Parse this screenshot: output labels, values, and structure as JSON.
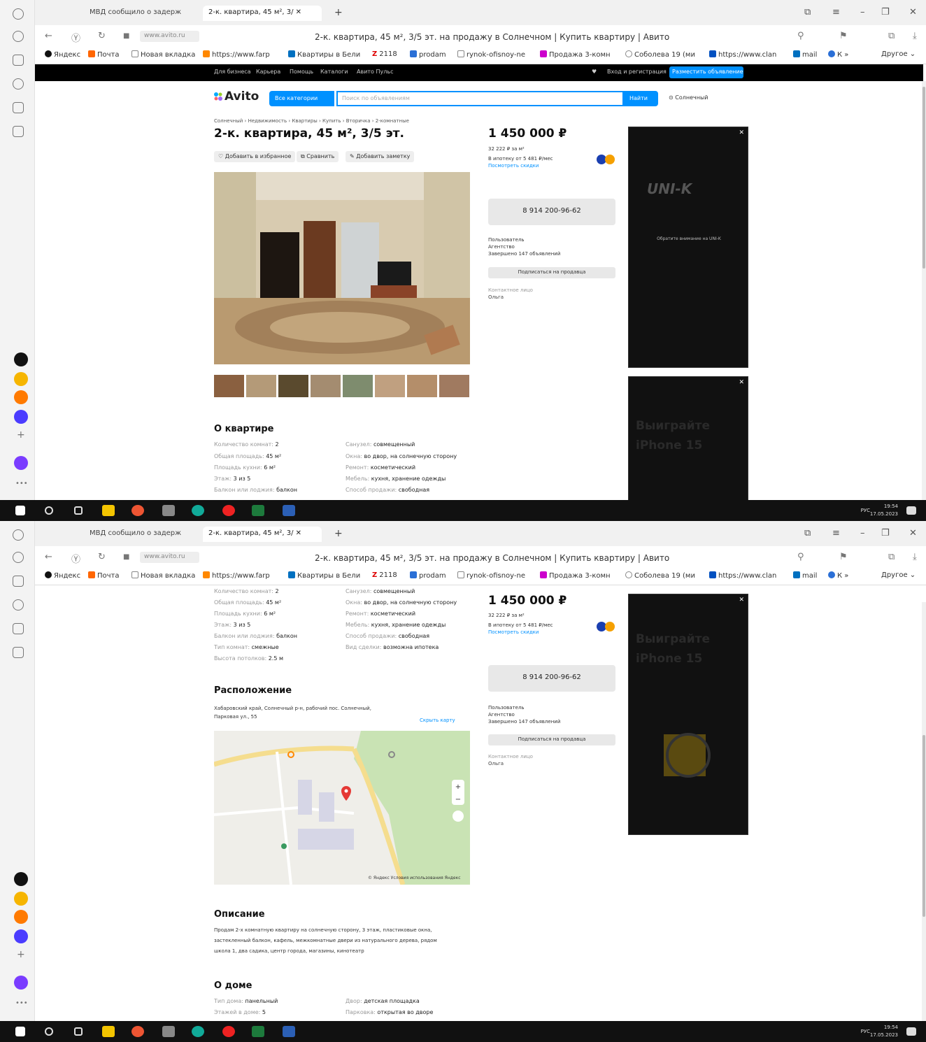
{
  "browser": {
    "tabs": [
      "МВД сообщило о задерж",
      "2-к. квартира, 45 м², 3/"
    ],
    "domain": "www.avito.ru",
    "page_title": "2-к. квартира, 45 м², 3/5 эт. на продажу в Солнечном | Купить квартиру | Авито",
    "bookmarks": [
      "Яндекс",
      "Почта",
      "Новая вкладка",
      "https://www.farp",
      "Квартиры в Бели",
      "2118",
      "prodam",
      "rynok-ofisnoy-ne",
      "Продажа 3-комн",
      "Соболева 19 (ми",
      "https://www.clan",
      "mail",
      "К"
    ],
    "bookmarks_other": "Другое"
  },
  "avito_topnav": {
    "links": [
      "Для бизнеса",
      "Карьера",
      "Помощь",
      "Каталоги",
      "Авито Пульс"
    ],
    "login": "Вход и регистрация",
    "post_button": "Разместить объявление"
  },
  "search": {
    "logo": "Avito",
    "category_button": "Все категории",
    "placeholder": "Поиск по объявлениям",
    "search_button": "Найти",
    "location": "Солнечный"
  },
  "listing": {
    "breadcrumbs": "Солнечный › Недвижимость › Квартиры › Купить › Вторичка › 2-комнатные",
    "title": "2-к. квартира, 45 м², 3/5 эт.",
    "actions": [
      "Добавить в избранное",
      "Сравнить",
      "Добавить заметку"
    ],
    "price": "1 450 000 ₽",
    "price_per_m2": "32 222 ₽ за м²",
    "mortgage": "В ипотеку от 5 481 ₽/мес",
    "mortgage_link": "Посмотреть скидки",
    "phone": "8 914 200-96-62",
    "seller": [
      "Пользователь",
      "Агентство",
      "Завершено 147 объявлений"
    ],
    "subscribe": "Подписаться на продавца",
    "contact_label": "Контактное лицо",
    "contact_name": "Ольга"
  },
  "about": {
    "heading": "О квартире",
    "left": [
      {
        "k": "Количество комнат:",
        "v": "2"
      },
      {
        "k": "Общая площадь:",
        "v": "45 м²"
      },
      {
        "k": "Площадь кухни:",
        "v": "6 м²"
      },
      {
        "k": "Этаж:",
        "v": "3 из 5"
      },
      {
        "k": "Балкон или лоджия:",
        "v": "балкон"
      },
      {
        "k": "Тип комнат:",
        "v": "смежные"
      },
      {
        "k": "Высота потолков:",
        "v": "2.5 м"
      }
    ],
    "right": [
      {
        "k": "Санузел:",
        "v": "совмещенный"
      },
      {
        "k": "Окна:",
        "v": "во двор, на солнечную сторону"
      },
      {
        "k": "Ремонт:",
        "v": "косметический"
      },
      {
        "k": "Мебель:",
        "v": "кухня, хранение одежды"
      },
      {
        "k": "Способ продажи:",
        "v": "свободная"
      },
      {
        "k": "Вид сделки:",
        "v": "возможна ипотека"
      }
    ]
  },
  "location_section": {
    "heading": "Расположение",
    "address": [
      "Хабаровский край, Солнечный р-н, рабочий пос. Солнечный,",
      "Парковая ул., 55"
    ],
    "map_link": "Скрыть карту",
    "map_footer": "© Яндекс  Условия использования  Яндекс"
  },
  "description": {
    "heading": "Описание",
    "lines": [
      "Продам 2-х комнатную квартиру на солнечную сторону, 3 этаж, пластиковые окна,",
      "застекленный балкон, кафель, межкомнатные двери из натурального дерева, рядом",
      "школа 1, два садика, центр города, магазины, кинотеатр"
    ]
  },
  "house": {
    "heading": "О доме",
    "left": [
      {
        "k": "Тип дома:",
        "v": "панельный"
      },
      {
        "k": "Этажей в доме:",
        "v": "5"
      }
    ],
    "right": [
      {
        "k": "Двор:",
        "v": "детская площадка"
      },
      {
        "k": "Парковка:",
        "v": "открытая во дворе"
      }
    ]
  },
  "ads": {
    "ad1_brand": "UNI-K",
    "ad1_text": "Обратите внимание на UNI-K",
    "ad2_text": "Выиграйте iPhone 15"
  },
  "taskbar": {
    "time": "19:54",
    "date": "17.05.2023",
    "lang": "РУС"
  },
  "colors": {
    "accent": "#0091ff",
    "ad_bg": "#111111",
    "taskbar": "#111111"
  }
}
